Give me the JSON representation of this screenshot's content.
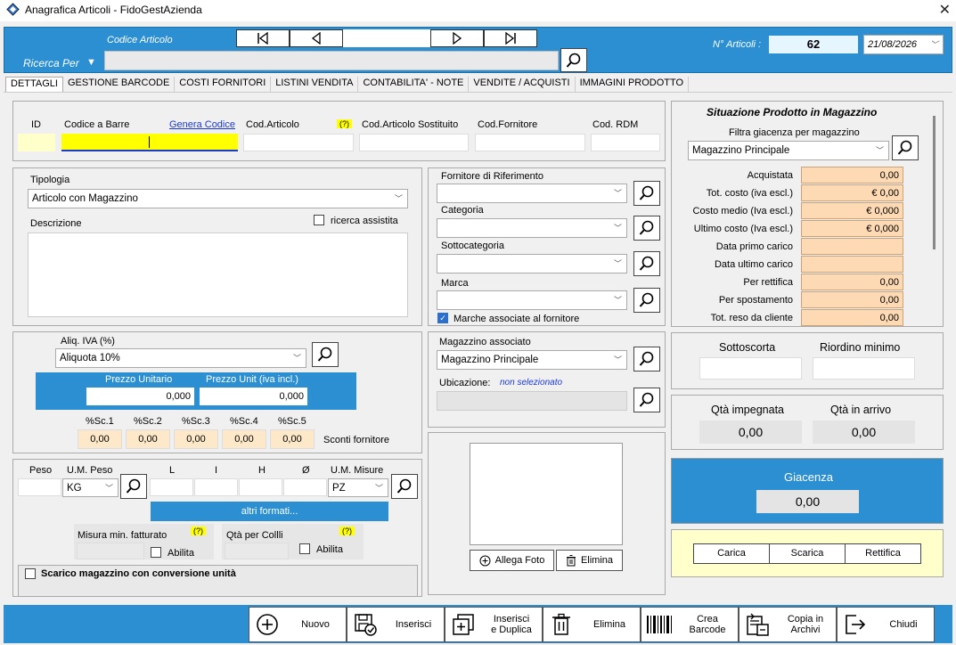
{
  "window": {
    "title": "Anagrafica Articoli - FidoGestAzienda"
  },
  "header": {
    "codice_articolo_label": "Codice Articolo",
    "ricerca_label": "Ricerca Per",
    "n_articoli_label": "N° Articoli :",
    "n_articoli_value": "62",
    "date_value": "21/08/2026"
  },
  "tabs": [
    "DETTAGLI",
    "GESTIONE BARCODE",
    "COSTI FORNITORI",
    "LISTINI VENDITA",
    "CONTABILITA' - NOTE",
    "VENDITE / ACQUISTI",
    "IMMAGINI PRODOTTO"
  ],
  "codes": {
    "id_label": "ID",
    "barre_label": "Codice a Barre",
    "genera_label": "Genera Codice",
    "codart_label": "Cod.Articolo",
    "help": "(?)",
    "sostituito_label": "Cod.Articolo Sostituito",
    "fornitore_label": "Cod.Fornitore",
    "rdm_label": "Cod. RDM"
  },
  "tipologia": {
    "label": "Tipologia",
    "value": "Articolo con Magazzino",
    "descrizione_label": "Descrizione",
    "ricerca_assistita": "ricerca assistita"
  },
  "fornitore": {
    "label": "Fornitore di Riferimento",
    "categoria_label": "Categoria",
    "sottocategoria_label": "Sottocategoria",
    "marca_label": "Marca",
    "marche_associate": "Marche associate al fornitore"
  },
  "iva": {
    "label": "Aliq. IVA (%)",
    "value": "Aliquota 10%",
    "prezzo_unitario_label": "Prezzo Unitario",
    "prezzo_unitario": "0,000",
    "prezzo_iva_label": "Prezzo Unit (iva incl.)",
    "prezzo_iva": "0,000",
    "sconti": [
      {
        "label": "%Sc.1",
        "value": "0,00"
      },
      {
        "label": "%Sc.2",
        "value": "0,00"
      },
      {
        "label": "%Sc.3",
        "value": "0,00"
      },
      {
        "label": "%Sc.4",
        "value": "0,00"
      },
      {
        "label": "%Sc.5",
        "value": "0,00"
      }
    ],
    "sconti_fornitore": "Sconti fornitore"
  },
  "magazzino_assoc": {
    "label": "Magazzino associato",
    "value": "Magazzino Principale",
    "ubicazione_label": "Ubicazione:",
    "ubicazione_value": "non selezionato"
  },
  "misure": {
    "peso_label": "Peso",
    "um_peso_label": "U.M. Peso",
    "um_peso_value": "KG",
    "l_label": "L",
    "i_label": "I",
    "h_label": "H",
    "o_label": "Ø",
    "um_misure_label": "U.M. Misure",
    "um_misure_value": "PZ",
    "altri_formati": "altri formati...",
    "misura_min_label": "Misura min. fatturato",
    "qta_colli_label": "Qtà per Collli",
    "abilita": "Abilita",
    "scarico_label": "Scarico magazzino con conversione unità"
  },
  "foto": {
    "allega": "Allega Foto",
    "elimina": "Elimina"
  },
  "situazione": {
    "title": "Situazione Prodotto in Magazzino",
    "filtra_label": "Filtra giacenza per magazzino",
    "filtra_value": "Magazzino Principale",
    "rows": [
      {
        "label": "Acquistata",
        "value": "0,00"
      },
      {
        "label": "Tot. costo (iva escl.)",
        "value": "€ 0,00"
      },
      {
        "label": "Costo medio (Iva escl.)",
        "value": "€ 0,000"
      },
      {
        "label": "Ultimo costo (Iva escl.)",
        "value": "€ 0,000"
      },
      {
        "label": "Data primo carico",
        "value": ""
      },
      {
        "label": "Data ultimo carico",
        "value": ""
      },
      {
        "label": "Per rettifica",
        "value": "0,00"
      },
      {
        "label": "Per spostamento",
        "value": "0,00"
      },
      {
        "label": "Tot. reso da cliente",
        "value": "0,00"
      }
    ]
  },
  "scorte": {
    "sottoscorta_label": "Sottoscorta",
    "riordino_label": "Riordino minimo"
  },
  "qta": {
    "impegnata_label": "Qtà impegnata",
    "impegnata": "0,00",
    "arrivo_label": "Qtà in arrivo",
    "arrivo": "0,00"
  },
  "giacenza": {
    "label": "Giacenza",
    "value": "0,00"
  },
  "movimenti": {
    "carica": "Carica",
    "scarica": "Scarica",
    "rettifica": "Rettifica"
  },
  "toolbar": {
    "nuovo": "Nuovo",
    "inserisci": "Inserisci",
    "inserisci_duplica_1": "Inserisci",
    "inserisci_duplica_2": "e Duplica",
    "elimina": "Elimina",
    "crea_barcode_1": "Crea",
    "crea_barcode_2": "Barcode",
    "copia_1": "Copia in",
    "copia_2": "Archivi",
    "chiudi": "Chiudi"
  }
}
